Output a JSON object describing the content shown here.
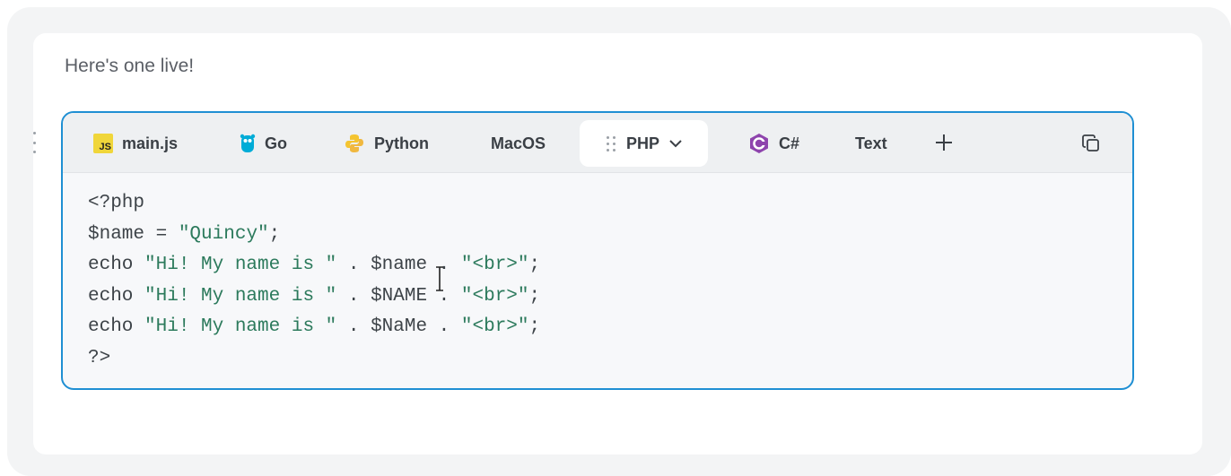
{
  "intro_text": "Here's one live!",
  "tabs": [
    {
      "label": "main.js",
      "icon": "javascript-icon",
      "icon_text": "JS"
    },
    {
      "label": "Go",
      "icon": "go-gopher-icon"
    },
    {
      "label": "Python",
      "icon": "python-icon"
    },
    {
      "label": "MacOS",
      "icon": ""
    },
    {
      "label": "PHP",
      "icon": "drag-grip-icon",
      "active": true
    },
    {
      "label": "C#",
      "icon": "csharp-icon"
    },
    {
      "label": "Text",
      "icon": ""
    }
  ],
  "code": {
    "line1": "<?php",
    "line2_var": "$name = ",
    "line2_str": "\"Quincy\"",
    "line2_end": ";",
    "line3_pre": "echo ",
    "line3_str": "\"Hi! My name is \"",
    "line3_mid": " . $name . ",
    "line3_str2": "\"<br>\"",
    "line3_end": ";",
    "line4_pre": "echo ",
    "line4_str": "\"Hi! My name is \"",
    "line4_mid": " . $NAME . ",
    "line4_str2": "\"<br>\"",
    "line4_end": ";",
    "line5_pre": "echo ",
    "line5_str": "\"Hi! My name is \"",
    "line5_mid": " . $NaMe . ",
    "line5_str2": "\"<br>\"",
    "line5_end": ";",
    "line6": "?>"
  },
  "colors": {
    "accent": "#1f8fd3",
    "string": "#2c7a5c",
    "csharp": "#8e44ad",
    "js": "#f0d63a",
    "go": "#00acd7"
  }
}
